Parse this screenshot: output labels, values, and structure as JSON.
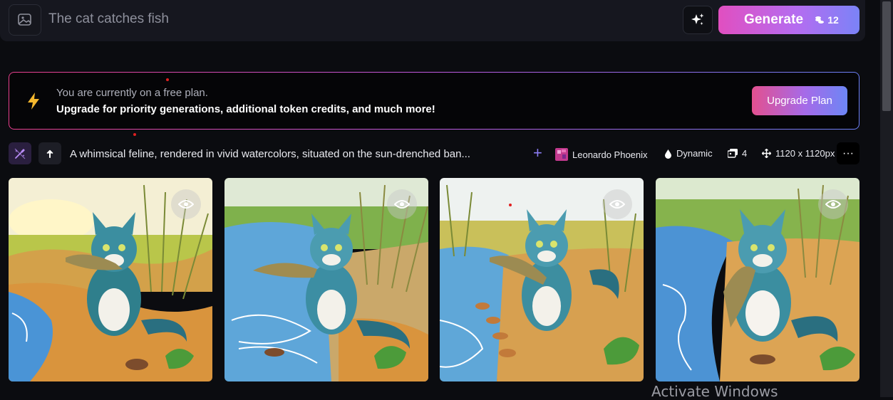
{
  "prompt_bar": {
    "prompt_text": "The cat catches fish",
    "generate_label": "Generate",
    "token_cost": "12"
  },
  "plan_banner": {
    "line1": "You are currently on a free plan.",
    "line2": "Upgrade for priority generations, additional token credits, and much more!",
    "upgrade_label": "Upgrade Plan"
  },
  "generation": {
    "prompt": "A whimsical feline, rendered in vivid watercolors, situated on the sun-drenched ban...",
    "model": "Leonardo Phoenix",
    "style": "Dynamic",
    "image_count": "4",
    "dimensions": "1120 x 1120px",
    "more_label": "···"
  },
  "gallery": {
    "images": [
      {
        "description": "watercolor cat holding fish by river"
      },
      {
        "description": "watercolor cat holding fish by river"
      },
      {
        "description": "watercolor cat holding fish by river"
      },
      {
        "description": "watercolor cat holding fish by river"
      }
    ]
  },
  "os_overlay": {
    "activate_text": "Activate Windows"
  },
  "colors": {
    "accent_pink": "#e14fc0",
    "accent_blue": "#7b83f7",
    "background": "#0b0c10"
  }
}
